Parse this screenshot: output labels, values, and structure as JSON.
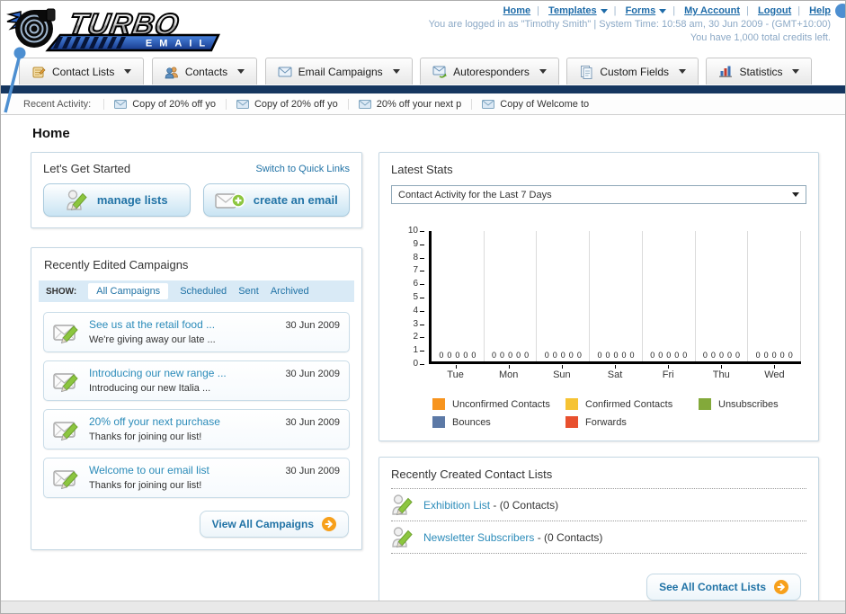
{
  "header": {
    "logo": {
      "title": "TURBO",
      "subtitle": "EMAIL"
    },
    "nav": [
      {
        "label": "Home",
        "dropdown": false
      },
      {
        "label": "Templates",
        "dropdown": true
      },
      {
        "label": "Forms",
        "dropdown": true
      },
      {
        "label": "My Account",
        "dropdown": false
      },
      {
        "label": "Logout",
        "dropdown": false
      },
      {
        "label": "Help",
        "dropdown": false
      }
    ],
    "login_line": "You are logged in as \"Timothy Smith\" | System Time: 10:58 am, 30 Jun 2009 - (GMT+10:00)",
    "credits_line": "You have 1,000 total credits left."
  },
  "tabs": [
    {
      "label": "Contact Lists"
    },
    {
      "label": "Contacts"
    },
    {
      "label": "Email Campaigns"
    },
    {
      "label": "Autoresponders"
    },
    {
      "label": "Custom Fields"
    },
    {
      "label": "Statistics"
    }
  ],
  "recent_activity": {
    "label": "Recent Activity:",
    "items": [
      "Copy of 20% off yo",
      "Copy of 20% off yo",
      "20% off your next p",
      "Copy of Welcome to"
    ]
  },
  "page_title": "Home",
  "get_started": {
    "title": "Let's Get Started",
    "switch_link": "Switch to Quick Links",
    "manage_lists_label": "manage lists",
    "create_email_label": "create an email"
  },
  "campaigns": {
    "title": "Recently Edited Campaigns",
    "show_label": "SHOW:",
    "filters": [
      "All Campaigns",
      "Scheduled",
      "Sent",
      "Archived"
    ],
    "active_filter": "All Campaigns",
    "items": [
      {
        "title": "See us at the retail food ...",
        "subtitle": "We're giving away our late ...",
        "date": "30 Jun 2009"
      },
      {
        "title": "Introducing our new range ...",
        "subtitle": "Introducing our new Italia ...",
        "date": "30 Jun 2009"
      },
      {
        "title": "20% off your next purchase",
        "subtitle": "Thanks for joining our list!",
        "date": "30 Jun 2009"
      },
      {
        "title": "Welcome to our email list",
        "subtitle": "Thanks for joining our list!",
        "date": "30 Jun 2009"
      }
    ],
    "view_all_label": "View All Campaigns"
  },
  "latest_stats": {
    "title": "Latest Stats",
    "dropdown_value": "Contact Activity for the Last 7 Days"
  },
  "chart_data": {
    "type": "bar",
    "title": "Contact Activity for the Last 7 Days",
    "categories": [
      "Tue",
      "Mon",
      "Sun",
      "Sat",
      "Fri",
      "Thu",
      "Wed"
    ],
    "series": [
      {
        "name": "Unconfirmed Contacts",
        "color": "#F7941E",
        "values": [
          0,
          0,
          0,
          0,
          0,
          0,
          0
        ]
      },
      {
        "name": "Confirmed Contacts",
        "color": "#F6C333",
        "values": [
          0,
          0,
          0,
          0,
          0,
          0,
          0
        ]
      },
      {
        "name": "Unsubscribes",
        "color": "#83A93A",
        "values": [
          0,
          0,
          0,
          0,
          0,
          0,
          0
        ]
      },
      {
        "name": "Bounces",
        "color": "#5C79A6",
        "values": [
          0,
          0,
          0,
          0,
          0,
          0,
          0
        ]
      },
      {
        "name": "Forwards",
        "color": "#E8502E",
        "values": [
          0,
          0,
          0,
          0,
          0,
          0,
          0
        ]
      }
    ],
    "xlabel": "",
    "ylabel": "",
    "ylim": [
      0,
      10
    ],
    "y_ticks": [
      0,
      1,
      2,
      3,
      4,
      5,
      6,
      7,
      8,
      9,
      10
    ],
    "grid": "vertical-group-separators",
    "legend_position": "bottom"
  },
  "contact_lists": {
    "title": "Recently Created Contact Lists",
    "items": [
      {
        "name": "Exhibition List",
        "detail": "- (0 Contacts)"
      },
      {
        "name": "Newsletter Subscribers",
        "detail": "- (0 Contacts)"
      }
    ],
    "see_all_label": "See All Contact Lists"
  },
  "annotation_color": "#4D8FD1"
}
